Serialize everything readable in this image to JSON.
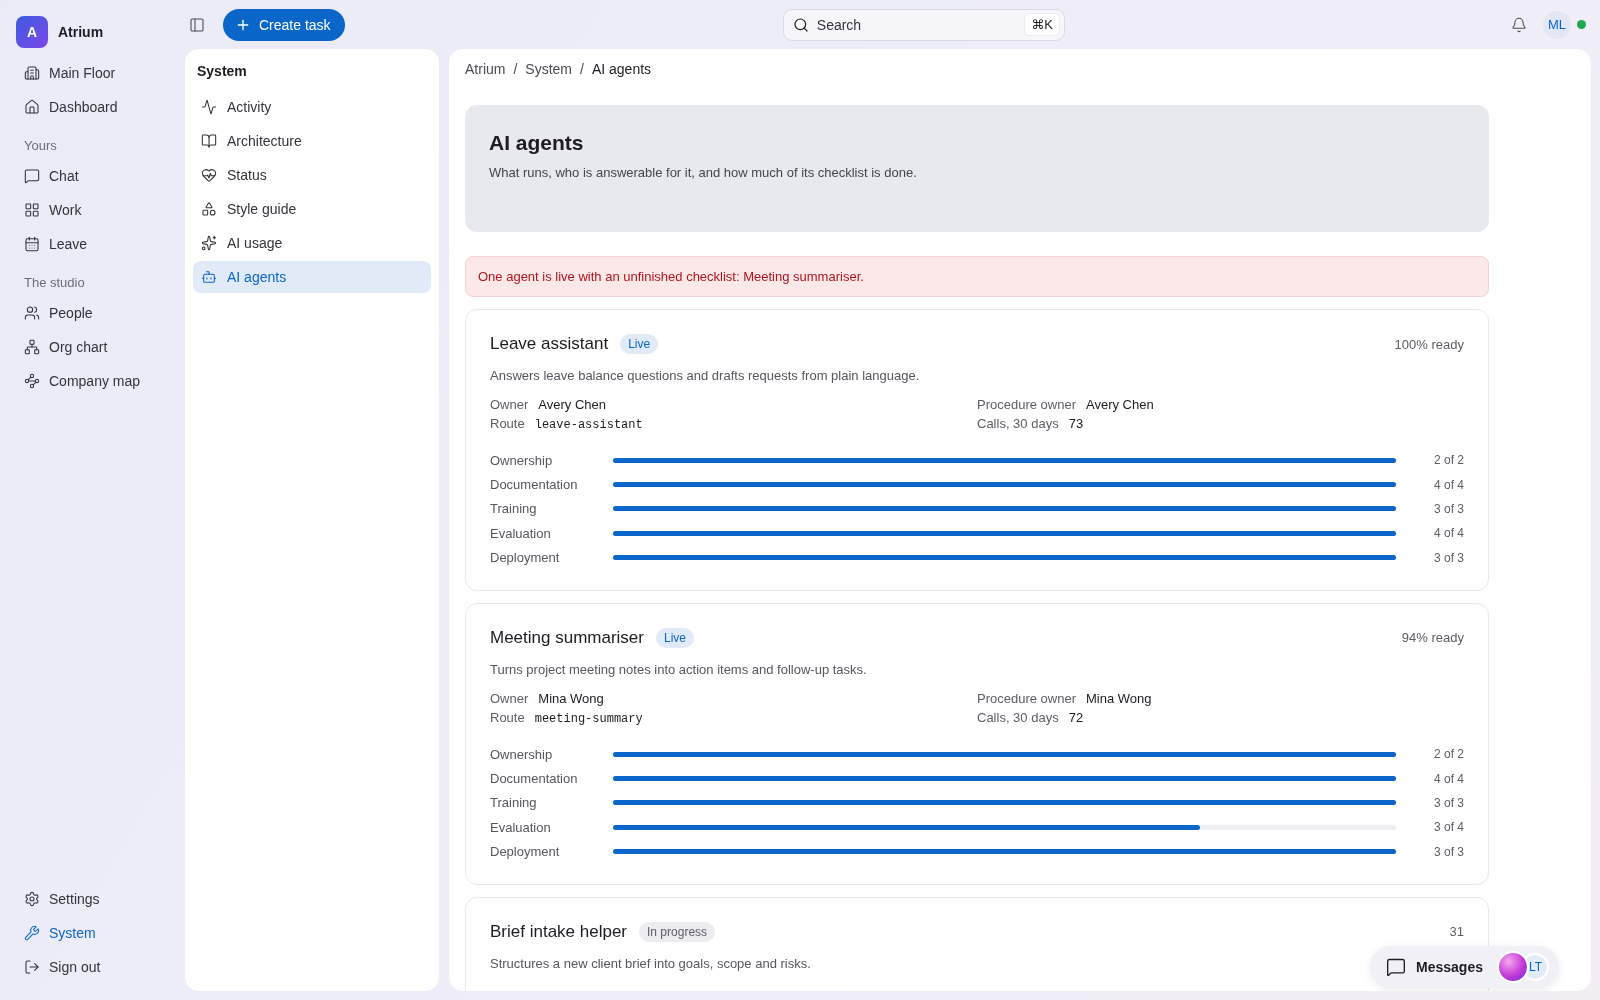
{
  "brand": {
    "initial": "A",
    "name": "Atrium"
  },
  "sidebar": {
    "top_items": [
      {
        "label": "Main Floor",
        "selected": false
      },
      {
        "label": "Dashboard",
        "selected": false
      }
    ],
    "sections": [
      {
        "heading": "Yours",
        "items": [
          {
            "label": "Chat",
            "selected": false
          },
          {
            "label": "Work",
            "selected": false
          },
          {
            "label": "Leave",
            "selected": false
          }
        ]
      },
      {
        "heading": "The studio",
        "items": [
          {
            "label": "People",
            "selected": false
          },
          {
            "label": "Org chart",
            "selected": false
          },
          {
            "label": "Company map",
            "selected": false
          }
        ]
      }
    ],
    "bottom_items": [
      {
        "label": "Settings",
        "selected": false
      },
      {
        "label": "System",
        "selected": true
      },
      {
        "label": "Sign out",
        "selected": false
      }
    ]
  },
  "toolbar": {
    "create_button": "Create task",
    "search": {
      "placeholder": "Search",
      "shortcut": "⌘K"
    },
    "user_initials": "ML",
    "online": true
  },
  "subnav": {
    "title": "System",
    "items": [
      {
        "label": "Activity",
        "selected": false
      },
      {
        "label": "Architecture",
        "selected": false
      },
      {
        "label": "Status",
        "selected": false
      },
      {
        "label": "Style guide",
        "selected": false
      },
      {
        "label": "AI usage",
        "selected": false
      },
      {
        "label": "AI agents",
        "selected": true
      }
    ]
  },
  "breadcrumb": {
    "separator": "/",
    "items": [
      "Atrium",
      "System",
      "AI agents"
    ]
  },
  "header": {
    "title": "AI agents",
    "subtitle": "What runs, who is answerable for it, and how much of its checklist is done."
  },
  "alert": "One agent is live with an unfinished checklist: Meeting summariser.",
  "agents": [
    {
      "name": "Leave assistant",
      "status": {
        "label": "Live",
        "kind": "live"
      },
      "readiness": "100% ready",
      "description": "Answers leave balance questions and drafts requests from plain language.",
      "owner_label": "Owner",
      "owner": "Avery Chen",
      "procedure_label": "Procedure owner",
      "procedure_owner": "Avery Chen",
      "route_label": "Route",
      "route": "leave-assistant",
      "calls_label": "Calls, 30 days",
      "calls": "73",
      "checklist": [
        {
          "label": "Ownership",
          "level": 1,
          "count": "2 of 2"
        },
        {
          "label": "Documentation",
          "level": 1,
          "count": "4 of 4"
        },
        {
          "label": "Training",
          "level": 1,
          "count": "3 of 3"
        },
        {
          "label": "Evaluation",
          "level": 1,
          "count": "4 of 4"
        },
        {
          "label": "Deployment",
          "level": 1,
          "count": "3 of 3"
        }
      ]
    },
    {
      "name": "Meeting summariser",
      "status": {
        "label": "Live",
        "kind": "live"
      },
      "readiness": "94% ready",
      "description": "Turns project meeting notes into action items and follow-up tasks.",
      "owner_label": "Owner",
      "owner": "Mina Wong",
      "procedure_label": "Procedure owner",
      "procedure_owner": "Mina Wong",
      "route_label": "Route",
      "route": "meeting-summary",
      "calls_label": "Calls, 30 days",
      "calls": "72",
      "checklist": [
        {
          "label": "Ownership",
          "level": 1,
          "count": "2 of 2"
        },
        {
          "label": "Documentation",
          "level": 1,
          "count": "4 of 4"
        },
        {
          "label": "Training",
          "level": 1,
          "count": "3 of 3"
        },
        {
          "label": "Evaluation",
          "level": 0.75,
          "count": "3 of 4"
        },
        {
          "label": "Deployment",
          "level": 1,
          "count": "3 of 3"
        }
      ]
    },
    {
      "name": "Brief intake helper",
      "status": {
        "label": "In progress",
        "kind": "progress"
      },
      "readiness": "31",
      "description": "Structures a new client brief into goals, scope and risks."
    }
  ],
  "messages_dock": {
    "label": "Messages",
    "avatar_initials": "LT"
  }
}
